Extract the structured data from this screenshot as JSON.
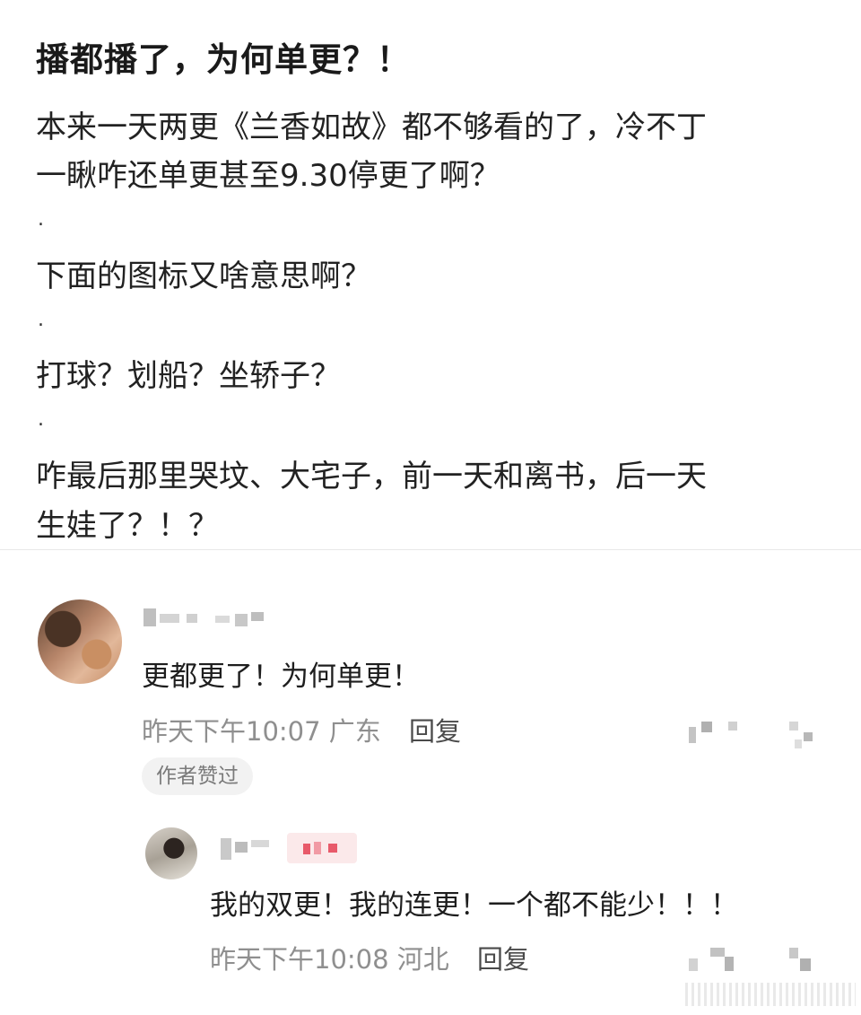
{
  "post": {
    "title": "播都播了，为何单更？！",
    "lines": [
      "本来一天两更《兰香如故》都不够看的了，冷不丁",
      "一瞅咋还单更甚至9.30停更了啊？",
      ".",
      "下面的图标又啥意思啊？",
      ".",
      "打球？划船？坐轿子？",
      ".",
      "咋最后那里哭坟、大宅子，前一天和离书，后一天",
      "生娃了？！？"
    ]
  },
  "comments": [
    {
      "text": "更都更了！为何单更！",
      "time": "昨天下午10:07",
      "location": "广东",
      "reply_label": "回复",
      "badge": "作者赞过",
      "avatar_icon": "user-avatar-icon"
    }
  ],
  "replies": [
    {
      "text": "我的双更！我的连更！一个都不能少！！！",
      "time": "昨天下午10:08",
      "location": "河北",
      "reply_label": "回复",
      "avatar_icon": "user-avatar-icon"
    }
  ],
  "colors": {
    "meta_gray": "#8f8f8f",
    "badge_bg": "#f2f2f2",
    "divider": "#e8e8e8",
    "tag_red": "#e85a6a"
  }
}
